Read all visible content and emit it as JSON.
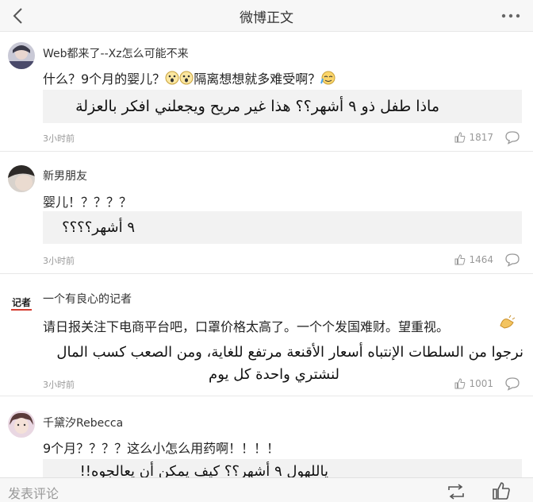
{
  "header": {
    "title": "微博正文",
    "back_icon": "chevron-left-icon",
    "more_icon": "more-dots-icon"
  },
  "comments": [
    {
      "username": "Web都来了--Xz怎么可能不来",
      "text_a": "什么？9个月的婴儿？",
      "text_b": "隔离想想就多难受啊？",
      "translation": "ماذا طفل ذو ٩ أشهر؟؟ هذا غير مريح ويجعلني افكر بالعزلة",
      "time": "3小时前",
      "likes": "1817"
    },
    {
      "username": "新男朋友",
      "text_a": "婴儿！？？？？",
      "translation": "٩ أشهر؟؟؟؟",
      "time": "3小时前",
      "likes": "1464"
    },
    {
      "username": "一个有良心的记者",
      "avatar_text": "记者",
      "text_a": "请日报关注下电商平台吧，口罩价格太高了。一个个发国难财。望重视。",
      "translation_line1": "نرجوا من السلطات الإنتباه أسعار الأقنعة مرتفع للغاية، ومن الصعب كسب المال",
      "translation_line2": "لنشتري واحدة كل يوم",
      "time": "3小时前",
      "likes": "1001"
    },
    {
      "username": "千黛汐Rebecca",
      "text_a": "9个月？？？？这么小怎么用药啊！！！！",
      "translation": "ياللهول ٩ أشهر؟؟ كيف يمكن أن يعالجوه!!"
    }
  ],
  "bottom": {
    "placeholder": "发表评论",
    "repost_icon": "repost-icon",
    "like_icon": "thumbs-up-icon"
  }
}
